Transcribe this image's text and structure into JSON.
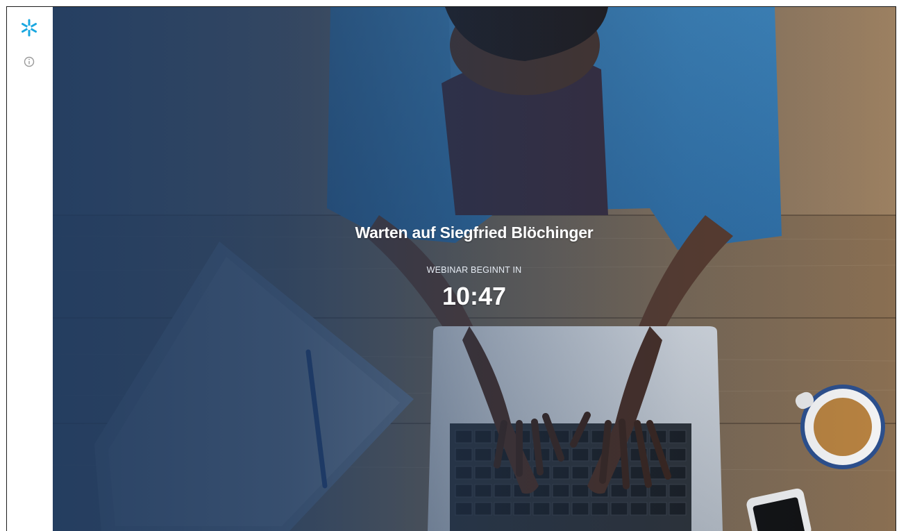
{
  "sidebar": {
    "logo_icon": "snowflake-icon",
    "info_icon": "info-icon",
    "accent_color": "#1aa7e0"
  },
  "waiting_screen": {
    "title": "Warten auf Siegfried Blöchinger",
    "countdown_label": "WEBINAR BEGINNT IN",
    "countdown_value": "10:47"
  }
}
